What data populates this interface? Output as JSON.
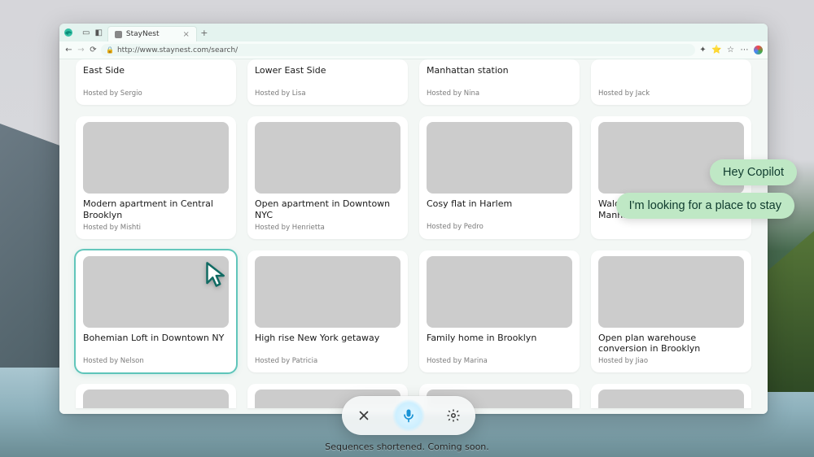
{
  "browser": {
    "tab_title": "StayNest",
    "url": "http://www.staynest.com/search/"
  },
  "listings_row0": [
    {
      "title": "East Side",
      "host": "Hosted by Sergio"
    },
    {
      "title": "Lower East Side",
      "host": "Hosted by Lisa"
    },
    {
      "title": "Manhattan station",
      "host": "Hosted by Nina"
    },
    {
      "title": "",
      "host": "Hosted by Jack"
    }
  ],
  "listings_row1": [
    {
      "title": "Modern apartment in Central Brooklyn",
      "host": "Hosted by Mishti"
    },
    {
      "title": "Open apartment in Downtown NYC",
      "host": "Hosted by Henrietta"
    },
    {
      "title": "Cosy flat in Harlem",
      "host": "Hosted by Pedro"
    },
    {
      "title": "Walden Apartment in Manhattan",
      "host": ""
    }
  ],
  "listings_row2": [
    {
      "title": "Bohemian Loft in Downtown NY",
      "host": "Hosted by Nelson"
    },
    {
      "title": "High rise New York getaway",
      "host": "Hosted by Patricia"
    },
    {
      "title": "Family home in Brooklyn",
      "host": "Hosted by Marina"
    },
    {
      "title": "Open plan warehouse conversion in Brooklyn",
      "host": "Hosted by Jiao"
    }
  ],
  "copilot": {
    "bubble1": "Hey Copilot",
    "bubble2": "I'm looking for a place to stay"
  },
  "disclaimer": "Sequences shortened. Coming soon."
}
